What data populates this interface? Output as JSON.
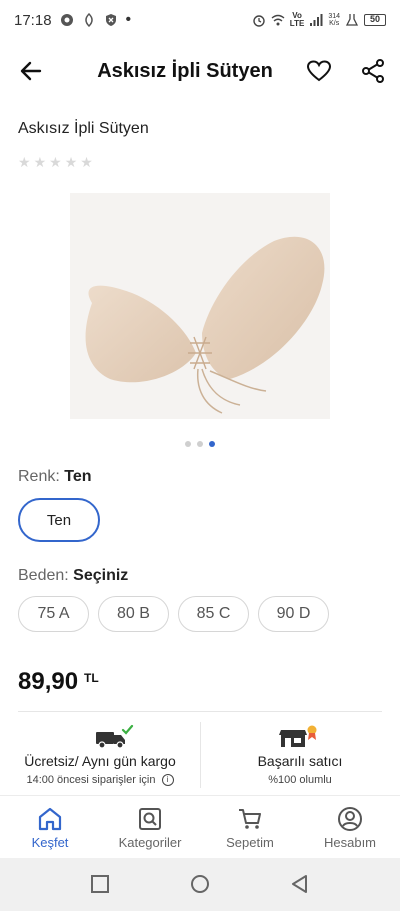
{
  "status_bar": {
    "time": "17:18",
    "network_label": "Vo\nLTE",
    "speed": "314\nK/s",
    "battery": "50"
  },
  "header": {
    "title": "Askısız İpli Sütyen"
  },
  "product": {
    "name": "Askısız İpli Sütyen",
    "rating_stars": 5,
    "image_count": 3,
    "active_image_index": 2
  },
  "color": {
    "label": "Renk:",
    "selected": "Ten",
    "options": [
      "Ten"
    ]
  },
  "size": {
    "label": "Beden:",
    "selected": "Seçiniz",
    "options": [
      "75 A",
      "80 B",
      "85 C",
      "90 D"
    ]
  },
  "price": {
    "value": "89,90",
    "currency": "TL"
  },
  "info": {
    "shipping_title": "Ücretsiz/ Aynı gün kargo",
    "shipping_sub": "14:00 öncesi siparişler için",
    "seller_title": "Başarılı satıcı",
    "seller_sub": "%100 olumlu"
  },
  "bottom_nav": {
    "items": [
      {
        "label": "Keşfet",
        "icon": "home-icon",
        "active": true
      },
      {
        "label": "Kategoriler",
        "icon": "category-search-icon",
        "active": false
      },
      {
        "label": "Sepetim",
        "icon": "cart-icon",
        "active": false
      },
      {
        "label": "Hesabım",
        "icon": "account-icon",
        "active": false
      }
    ]
  },
  "colors": {
    "accent": "#3366cc",
    "check_green": "#3cb043"
  }
}
